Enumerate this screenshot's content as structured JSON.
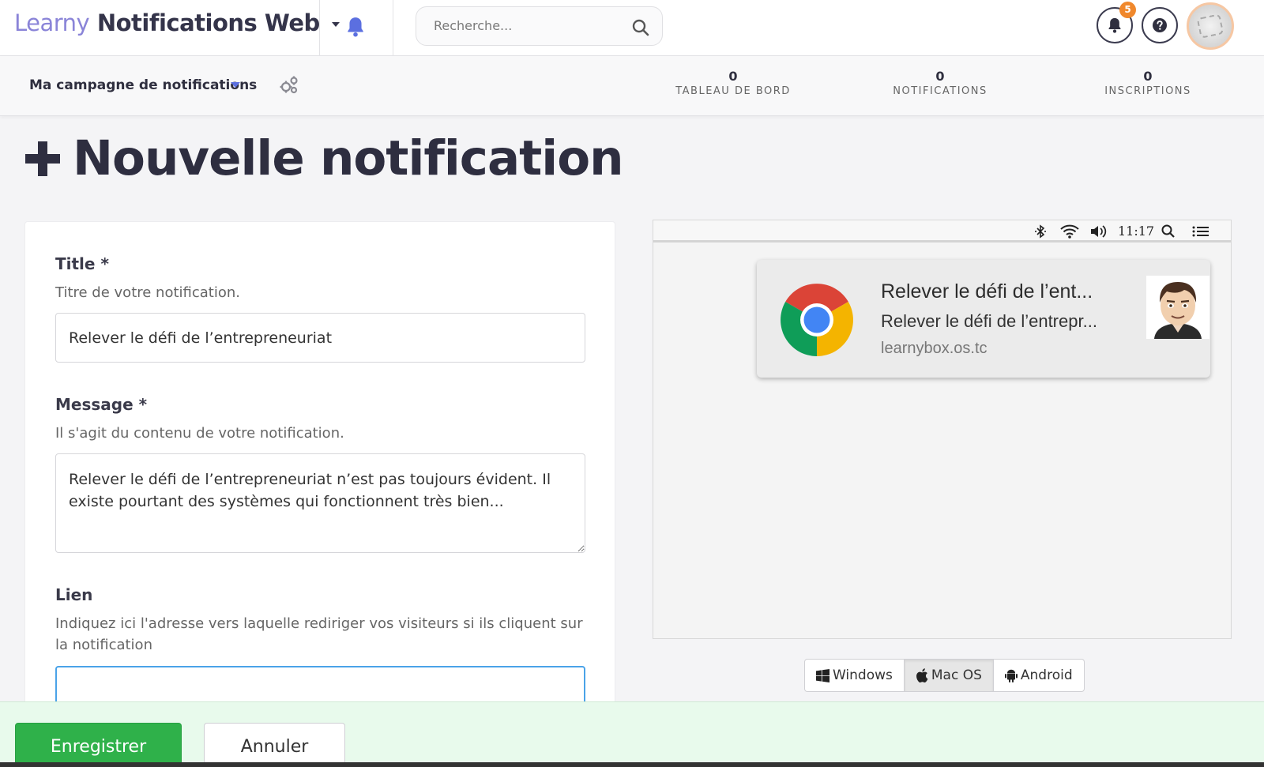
{
  "header": {
    "brand_prefix": "Learny",
    "brand_name": "Notifications Web",
    "search_placeholder": "Recherche...",
    "notifications_count": "5"
  },
  "campaign": {
    "name": "Ma campagne de notifications",
    "stats": [
      {
        "value": "0",
        "label": "TABLEAU DE BORD"
      },
      {
        "value": "0",
        "label": "NOTIFICATIONS"
      },
      {
        "value": "0",
        "label": "INSCRIPTIONS"
      }
    ]
  },
  "page": {
    "title": "Nouvelle notification"
  },
  "form": {
    "title_label": "Title *",
    "title_help": "Titre de votre notification.",
    "title_value": "Relever le défi de l’entrepreneuriat",
    "message_label": "Message *",
    "message_help": "Il s'agit du contenu de votre notification.",
    "message_value": "Relever le défi de l’entrepreneuriat n’est pas toujours évident. Il existe pourtant des systèmes qui fonctionnent très bien...",
    "link_label": "Lien",
    "link_help": "Indiquez ici l'adresse vers laquelle rediriger vos visiteurs si ils cliquent sur la notification",
    "link_value": ""
  },
  "preview": {
    "menubar_time": "11:17",
    "notification_title": "Relever le défi de l’ent...",
    "notification_message": "Relever le défi de l’entrepr...",
    "notification_url": "learnybox.os.tc",
    "os_options": [
      "Windows",
      "Mac OS",
      "Android"
    ],
    "selected_os": "Mac OS"
  },
  "footer": {
    "save_label": "Enregistrer",
    "cancel_label": "Annuler"
  },
  "colors": {
    "brand_light": "#8a84d8",
    "brand_dark": "#34344a",
    "accent_blue": "#5b6fe0",
    "badge_orange": "#f0882c",
    "save_green": "#2fb14a",
    "footer_bg": "#e8faec"
  }
}
